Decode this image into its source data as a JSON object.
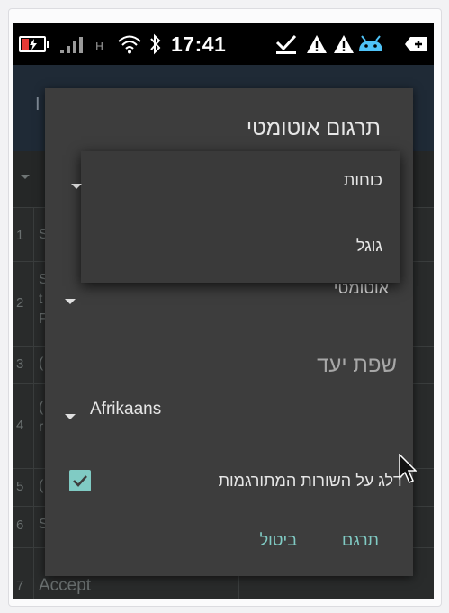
{
  "status_bar": {
    "time": "17:41",
    "network_type": "H",
    "battery_level": 0.35,
    "colors": {
      "battery_fill": "#e53935",
      "notification_android": "#4fc3f7"
    },
    "icons": [
      "battery-icon",
      "signal-icon",
      "wifi-icon",
      "bluetooth-icon",
      "check-icon",
      "warning-icon",
      "warning-icon",
      "android-icon",
      "tag-icon"
    ]
  },
  "background_app": {
    "title_fragment": "I",
    "row_numbers": [
      "1",
      "2",
      "3",
      "4",
      "5",
      "6",
      "7"
    ],
    "row_fragments": [
      "S",
      "S",
      "t",
      "F",
      "(",
      "(",
      "r",
      "(",
      "S"
    ],
    "last_row_text": "Accept"
  },
  "dialog": {
    "title": "תרגום אוטומטי",
    "provider_spinner_value": "אוטומטי",
    "target_language_label": "שפת יעד",
    "target_language_value": "Afrikaans",
    "skip_translated_label": "דלג על השורות המתורגמות",
    "skip_translated_checked": true,
    "translate_button": "תרגם",
    "cancel_button": "ביטול",
    "accent_color": "#80cbc4"
  },
  "provider_popup": {
    "items": [
      "כוחות",
      "גוגל"
    ]
  }
}
